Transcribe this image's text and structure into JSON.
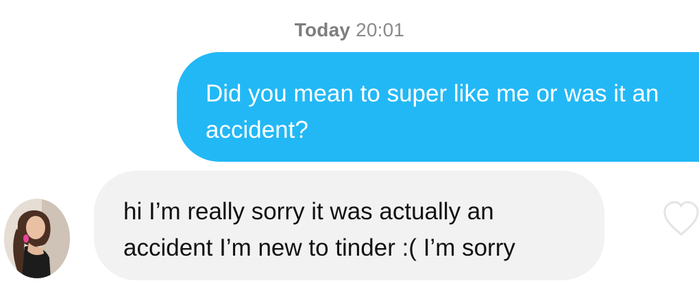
{
  "header": {
    "day_label": "Today",
    "time_label": "20:01"
  },
  "messages": [
    {
      "direction": "sent",
      "text": "Did you mean to super like me or was it an accident?"
    },
    {
      "direction": "received",
      "text": "hi I’m really sorry it was actually an accident I’m new to tinder :( I’m sorry"
    }
  ],
  "colors": {
    "sent_bubble": "#22b8f6",
    "received_bubble": "#f2f2f2",
    "timestamp_text": "#8a8a8a",
    "heart_outline": "#e4e4e4"
  },
  "icons": {
    "like": "heart-outline-icon",
    "avatar": "profile-photo"
  }
}
